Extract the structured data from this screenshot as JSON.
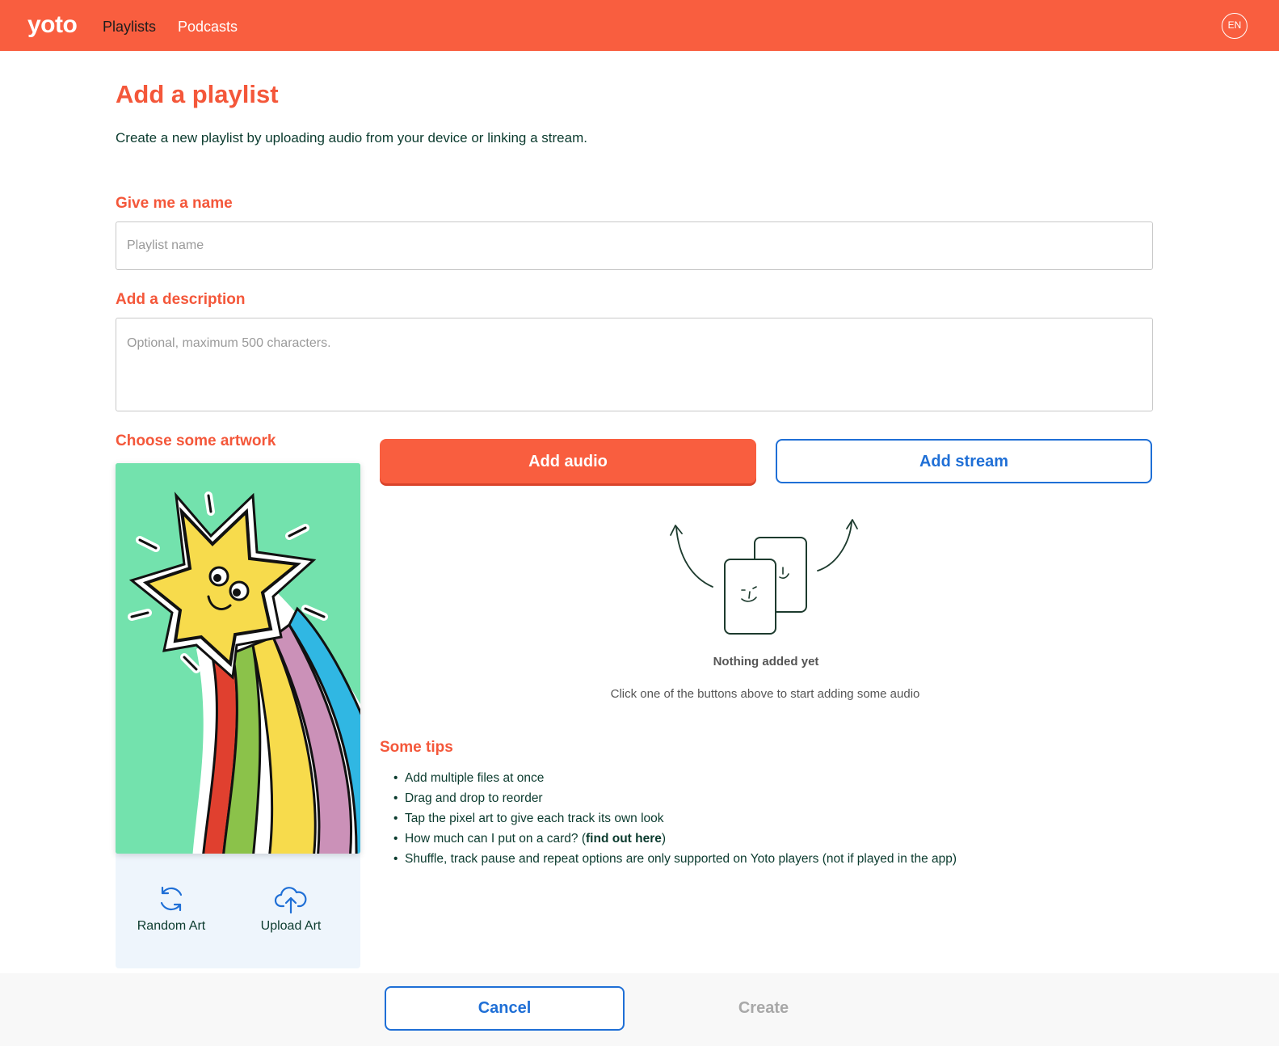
{
  "header": {
    "logo": "yoto",
    "nav": {
      "playlists": "Playlists",
      "podcasts": "Podcasts"
    },
    "language": "EN",
    "color": "#f95e3f"
  },
  "page": {
    "title": "Add a playlist",
    "intro": "Create a new playlist by uploading audio from your device or linking a stream."
  },
  "form": {
    "name_label": "Give me a name",
    "name_placeholder": "Playlist name",
    "name_value": "",
    "description_label": "Add a description",
    "description_placeholder": "Optional, maximum 500 characters.",
    "description_value": "",
    "artwork_label": "Choose some artwork"
  },
  "artwork": {
    "random_label": "Random Art",
    "random_icon": "refresh-icon",
    "upload_label": "Upload Art",
    "upload_icon": "cloud-upload-icon"
  },
  "audio": {
    "add_audio": "Add audio",
    "add_stream": "Add stream",
    "empty_title": "Nothing added yet",
    "empty_subtitle": "Click one of the buttons above to start adding some audio"
  },
  "tips": {
    "title": "Some tips",
    "items": {
      "t0": "Add multiple files at once",
      "t1": "Drag and drop to reorder",
      "t2": "Tap the pixel art to give each track its own look",
      "t3_prefix": "How much can I put on a card? (",
      "t3_link": "find out here",
      "t3_suffix": ")",
      "t4": "Shuffle, track pause and repeat options are only supported on Yoto players (not if played in the app)"
    }
  },
  "footer": {
    "cancel": "Cancel",
    "create": "Create"
  },
  "colors": {
    "accent": "#f95e3f",
    "link_blue": "#1f6fd6",
    "text_dark": "#0b3b2e",
    "artwork_bg": "#73e2ad"
  }
}
